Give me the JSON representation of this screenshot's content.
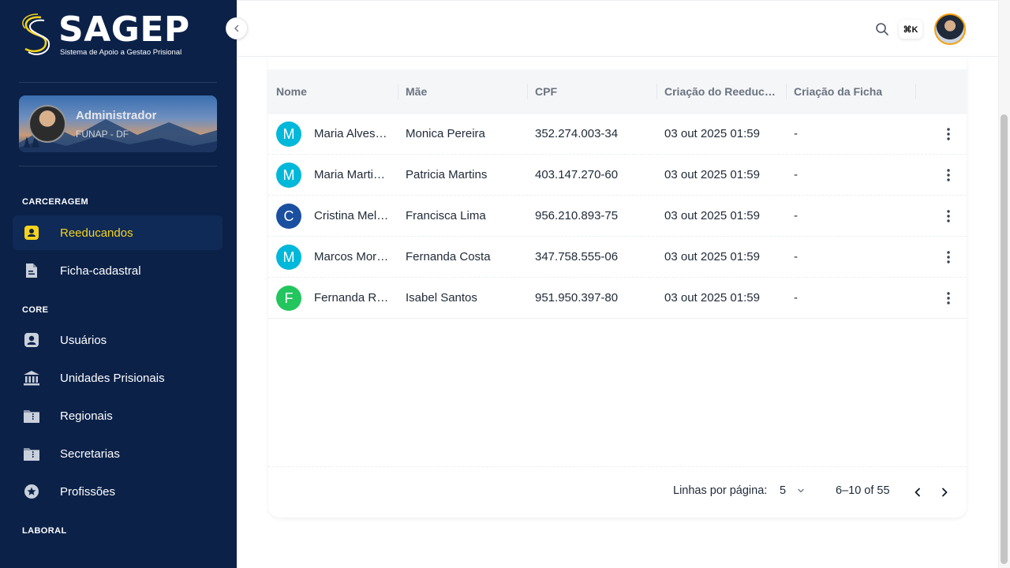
{
  "brand": {
    "name": "SAGEP",
    "subtitle": "Sistema de Apoio a Gestao Prisional"
  },
  "user": {
    "name": "Administrador",
    "organization": "FUNAP - DF"
  },
  "sidebar": {
    "sections": [
      {
        "label": "CARCERAGEM"
      },
      {
        "label": "CORE"
      },
      {
        "label": "LABORAL"
      }
    ],
    "items": [
      {
        "label": "Reeducandos",
        "icon": "user-badge-icon",
        "active": true
      },
      {
        "label": "Ficha-cadastral",
        "icon": "file-icon",
        "active": false
      },
      {
        "label": "Usuários",
        "icon": "user-icon",
        "active": false
      },
      {
        "label": "Unidades Prisionais",
        "icon": "bank-icon",
        "active": false
      },
      {
        "label": "Regionais",
        "icon": "folder-icon",
        "active": false
      },
      {
        "label": "Secretarias",
        "icon": "folder-icon",
        "active": false
      },
      {
        "label": "Profissões",
        "icon": "star-icon",
        "active": false
      }
    ]
  },
  "topbar": {
    "shortcut": "⌘K"
  },
  "table": {
    "columns": [
      "Nome",
      "Mãe",
      "CPF",
      "Criação do Reeducando",
      "Criação da Ficha"
    ],
    "rows": [
      {
        "initial": "M",
        "avatar_color": "#00b8d9",
        "name": "Maria Alves Santos",
        "mother": "Monica Pereira",
        "cpf": "352.274.003-34",
        "created": "03 out 2025 01:59",
        "form_created": "-"
      },
      {
        "initial": "M",
        "avatar_color": "#00b8d9",
        "name": "Maria Martins Silva",
        "mother": "Patricia Martins",
        "cpf": "403.147.270-60",
        "created": "03 out 2025 01:59",
        "form_created": "-"
      },
      {
        "initial": "C",
        "avatar_color": "#1b4fa0",
        "name": "Cristina Melo Lima",
        "mother": "Francisca Lima",
        "cpf": "956.210.893-75",
        "created": "03 out 2025 01:59",
        "form_created": "-"
      },
      {
        "initial": "M",
        "avatar_color": "#00b8d9",
        "name": "Marcos Moreira Costa",
        "mother": "Fernanda Costa",
        "cpf": "347.758.555-06",
        "created": "03 out 2025 01:59",
        "form_created": "-"
      },
      {
        "initial": "F",
        "avatar_color": "#22c55e",
        "name": "Fernanda Rocha Santos",
        "mother": "Isabel Santos",
        "cpf": "951.950.397-80",
        "created": "03 out 2025 01:59",
        "form_created": "-"
      }
    ]
  },
  "pagination": {
    "rows_per_page_label": "Linhas por página:",
    "rows_per_page": "5",
    "range": "6–10 of 55"
  }
}
